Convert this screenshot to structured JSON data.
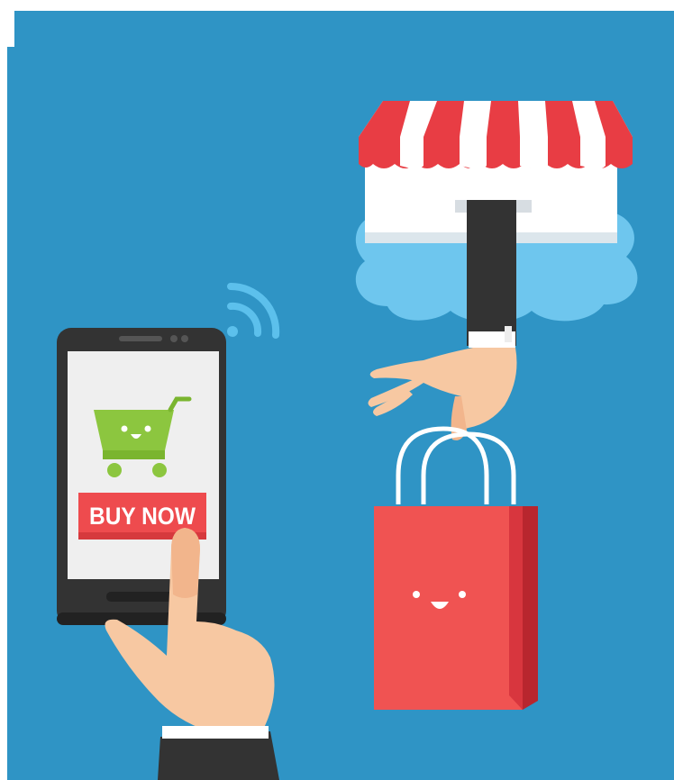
{
  "phone": {
    "buy_button_label": "BUY NOW",
    "screen_icon": "shopping-cart-icon"
  },
  "icons": {
    "wireless": "wifi-signal-icon",
    "store": "storefront-awning-icon",
    "bag": "shopping-bag-icon",
    "cloud": "cloud-icon"
  },
  "colors": {
    "background": "#2F94C5",
    "bag": "#F05352",
    "button": "#EE4B4E",
    "cart": "#8CC63F",
    "cloud": "#6EC6EE",
    "awning_red": "#E83D44",
    "skin": "#F7C8A2",
    "sleeve": "#333333"
  }
}
